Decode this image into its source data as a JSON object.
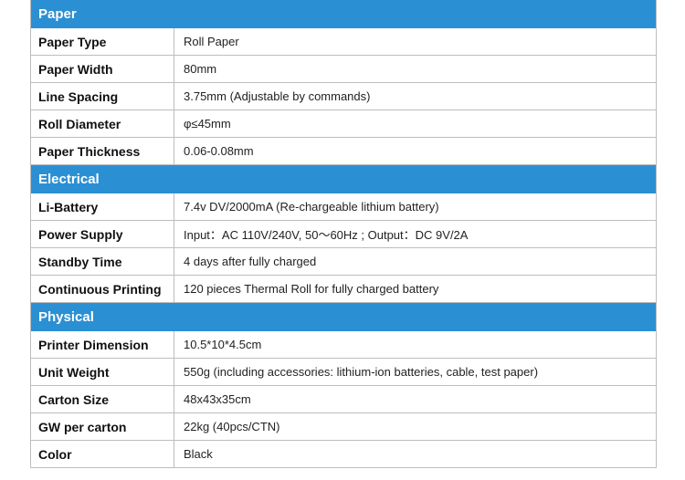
{
  "sections": [
    {
      "title": "Paper",
      "rows": [
        {
          "label": "Paper Type",
          "value": "Roll Paper"
        },
        {
          "label": "Paper Width",
          "value": "80mm"
        },
        {
          "label": "Line Spacing",
          "value": "3.75mm (Adjustable by commands)"
        },
        {
          "label": "Roll Diameter",
          "value": "φ≤45mm"
        },
        {
          "label": "Paper Thickness",
          "value": "0.06-0.08mm"
        }
      ]
    },
    {
      "title": "Electrical",
      "rows": [
        {
          "label": "Li-Battery",
          "value": "7.4v DV/2000mA (Re-chargeable lithium battery)"
        },
        {
          "label": "Power Supply",
          "value": "Input：AC 110V/240V, 50～60Hz ; Output：DC 9V/2A"
        },
        {
          "label": "Standby Time",
          "value": "4 days after fully charged"
        },
        {
          "label": "Continuous Printing",
          "value": "120 pieces Thermal Roll for fully charged battery"
        }
      ]
    },
    {
      "title": "Physical",
      "rows": [
        {
          "label": "Printer Dimension",
          "value": "10.5*10*4.5cm"
        },
        {
          "label": "Unit Weight",
          "value": "550g (including accessories: lithium-ion batteries, cable, test paper)"
        },
        {
          "label": "Carton Size",
          "value": "48x43x35cm"
        },
        {
          "label": "GW per carton",
          "value": "22kg (40pcs/CTN)"
        },
        {
          "label": "Color",
          "value": "Black"
        }
      ]
    }
  ],
  "colors": {
    "header_bg": "#2b8fd3",
    "border": "#bdbdbd"
  }
}
